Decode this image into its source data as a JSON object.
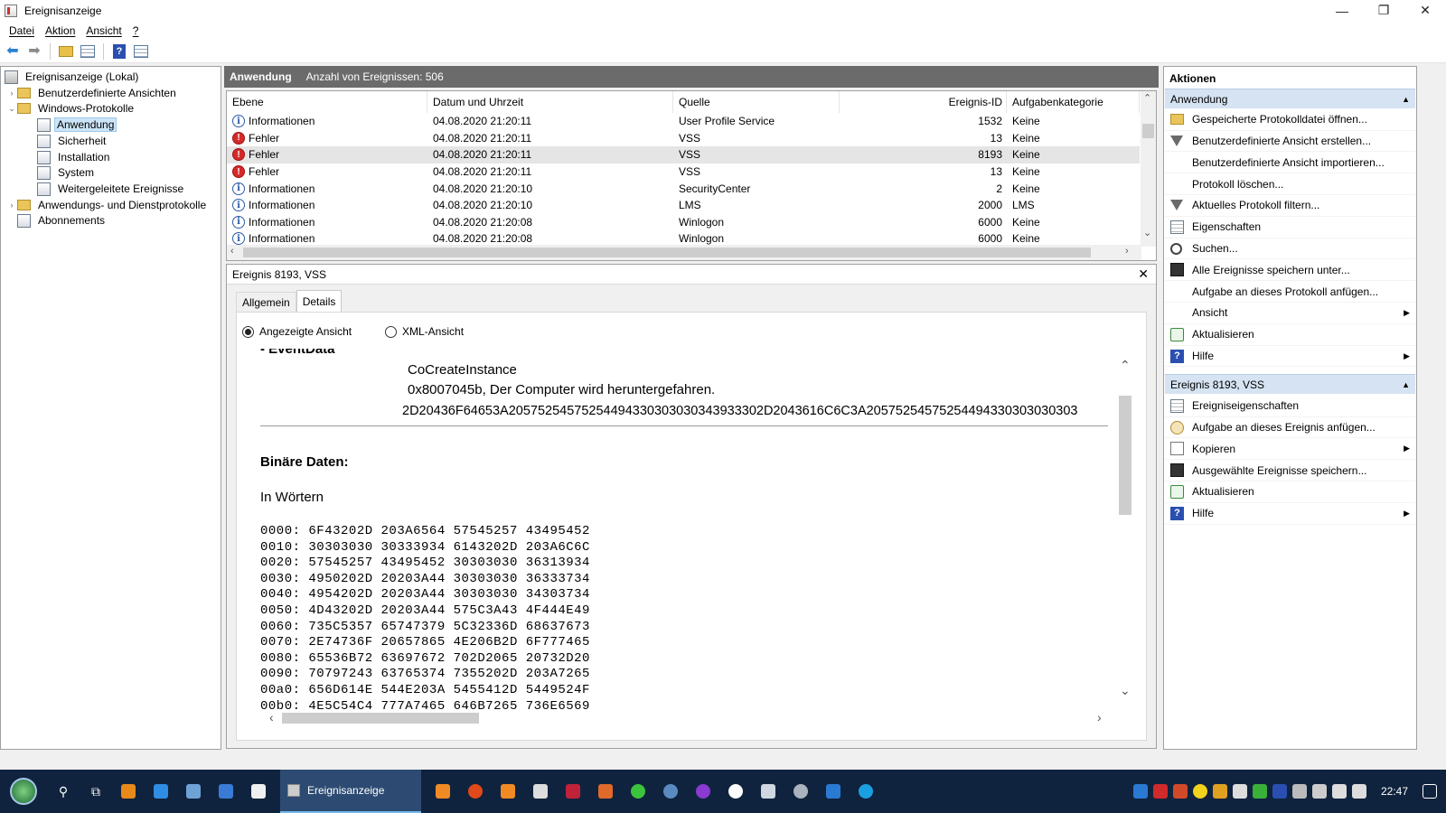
{
  "window": {
    "title": "Ereignisanzeige",
    "minimize": "—",
    "maximize": "❐",
    "close": "✕"
  },
  "menu": [
    "Datei",
    "Aktion",
    "Ansicht",
    "?"
  ],
  "tree": {
    "root": "Ereignisanzeige (Lokal)",
    "custom_views": "Benutzerdefinierte Ansichten",
    "windows_logs": "Windows-Protokolle",
    "logs": [
      "Anwendung",
      "Sicherheit",
      "Installation",
      "System",
      "Weitergeleitete Ereignisse"
    ],
    "app_service_logs": "Anwendungs- und Dienstprotokolle",
    "subscriptions": "Abonnements"
  },
  "list_header": {
    "title": "Anwendung",
    "count": "Anzahl von Ereignissen: 506"
  },
  "columns": {
    "level": "Ebene",
    "date": "Datum und Uhrzeit",
    "source": "Quelle",
    "id": "Ereignis-ID",
    "category": "Aufgabenkategorie"
  },
  "events": [
    {
      "level": "Informationen",
      "type": "info",
      "date": "04.08.2020 21:20:11",
      "source": "User Profile Service",
      "id": "1532",
      "category": "Keine"
    },
    {
      "level": "Fehler",
      "type": "error",
      "date": "04.08.2020 21:20:11",
      "source": "VSS",
      "id": "13",
      "category": "Keine"
    },
    {
      "level": "Fehler",
      "type": "error",
      "date": "04.08.2020 21:20:11",
      "source": "VSS",
      "id": "8193",
      "category": "Keine"
    },
    {
      "level": "Fehler",
      "type": "error",
      "date": "04.08.2020 21:20:11",
      "source": "VSS",
      "id": "13",
      "category": "Keine"
    },
    {
      "level": "Informationen",
      "type": "info",
      "date": "04.08.2020 21:20:10",
      "source": "SecurityCenter",
      "id": "2",
      "category": "Keine"
    },
    {
      "level": "Informationen",
      "type": "info",
      "date": "04.08.2020 21:20:10",
      "source": "LMS",
      "id": "2000",
      "category": "LMS"
    },
    {
      "level": "Informationen",
      "type": "info",
      "date": "04.08.2020 21:20:08",
      "source": "Winlogon",
      "id": "6000",
      "category": "Keine"
    },
    {
      "level": "Informationen",
      "type": "info",
      "date": "04.08.2020 21:20:08",
      "source": "Winlogon",
      "id": "6000",
      "category": "Keine"
    }
  ],
  "detail": {
    "title": "Ereignis 8193, VSS",
    "tabs": [
      "Allgemein",
      "Details"
    ],
    "radio_friendly": "Angezeigte Ansicht",
    "radio_xml": "XML-Ansicht",
    "eventdata_heading": "- EventData",
    "data_lines": [
      "CoCreateInstance",
      "0x8007045b, Der Computer wird heruntergefahren.",
      "2D20436F64653A20575254575254494330303030343933302D2043616C6C3A20575254575254494330303030303"
    ],
    "binary_heading": "Binäre Daten:",
    "words_label": "In Wörtern",
    "hex_lines": [
      "0000: 6F43202D 203A6564 57545257 43495452",
      "0010: 30303030 30333934 6143202D 203A6C6C",
      "0020: 57545257 43495452 30303030 36313934",
      "0030: 4950202D 20203A44 30303030 36333734",
      "0040: 4954202D 20203A44 30303030 34303734",
      "0050: 4D43202D 20203A44 575C3A43 4F444E49",
      "0060: 735C5357 65747379 5C32336D 68637673",
      "0070: 2E74736F 20657865 4E206B2D 6F777465",
      "0080: 65536B72 63697672 702D2065 20732D20",
      "0090: 70797243 63765374 7355202D 203A7265",
      "00a0: 656D614E 544E203A 5455412D 5449524F",
      "00b0: 4E5C54C4 777A7465 646B7265 736E6569"
    ]
  },
  "actions": {
    "title": "Aktionen",
    "section1": "Anwendung",
    "items1": [
      "Gespeicherte Protokolldatei öffnen...",
      "Benutzerdefinierte Ansicht erstellen...",
      "Benutzerdefinierte Ansicht importieren...",
      "Protokoll löschen...",
      "Aktuelles Protokoll filtern...",
      "Eigenschaften",
      "Suchen...",
      "Alle Ereignisse speichern unter...",
      "Aufgabe an dieses Protokoll anfügen...",
      "Ansicht",
      "Aktualisieren",
      "Hilfe"
    ],
    "section2": "Ereignis 8193, VSS",
    "items2": [
      "Ereigniseigenschaften",
      "Aufgabe an dieses Ereignis anfügen...",
      "Kopieren",
      "Ausgewählte Ereignisse speichern...",
      "Aktualisieren",
      "Hilfe"
    ]
  },
  "taskbar": {
    "active_app": "Ereignisanzeige",
    "clock": "22:47"
  },
  "colors": {
    "selection": "#cce4f7",
    "section_bg": "#d5e3f2",
    "header_bg": "#6b6b6b",
    "error": "#d52a2a",
    "info": "#2a5aa8",
    "taskbar": "#10233e"
  }
}
